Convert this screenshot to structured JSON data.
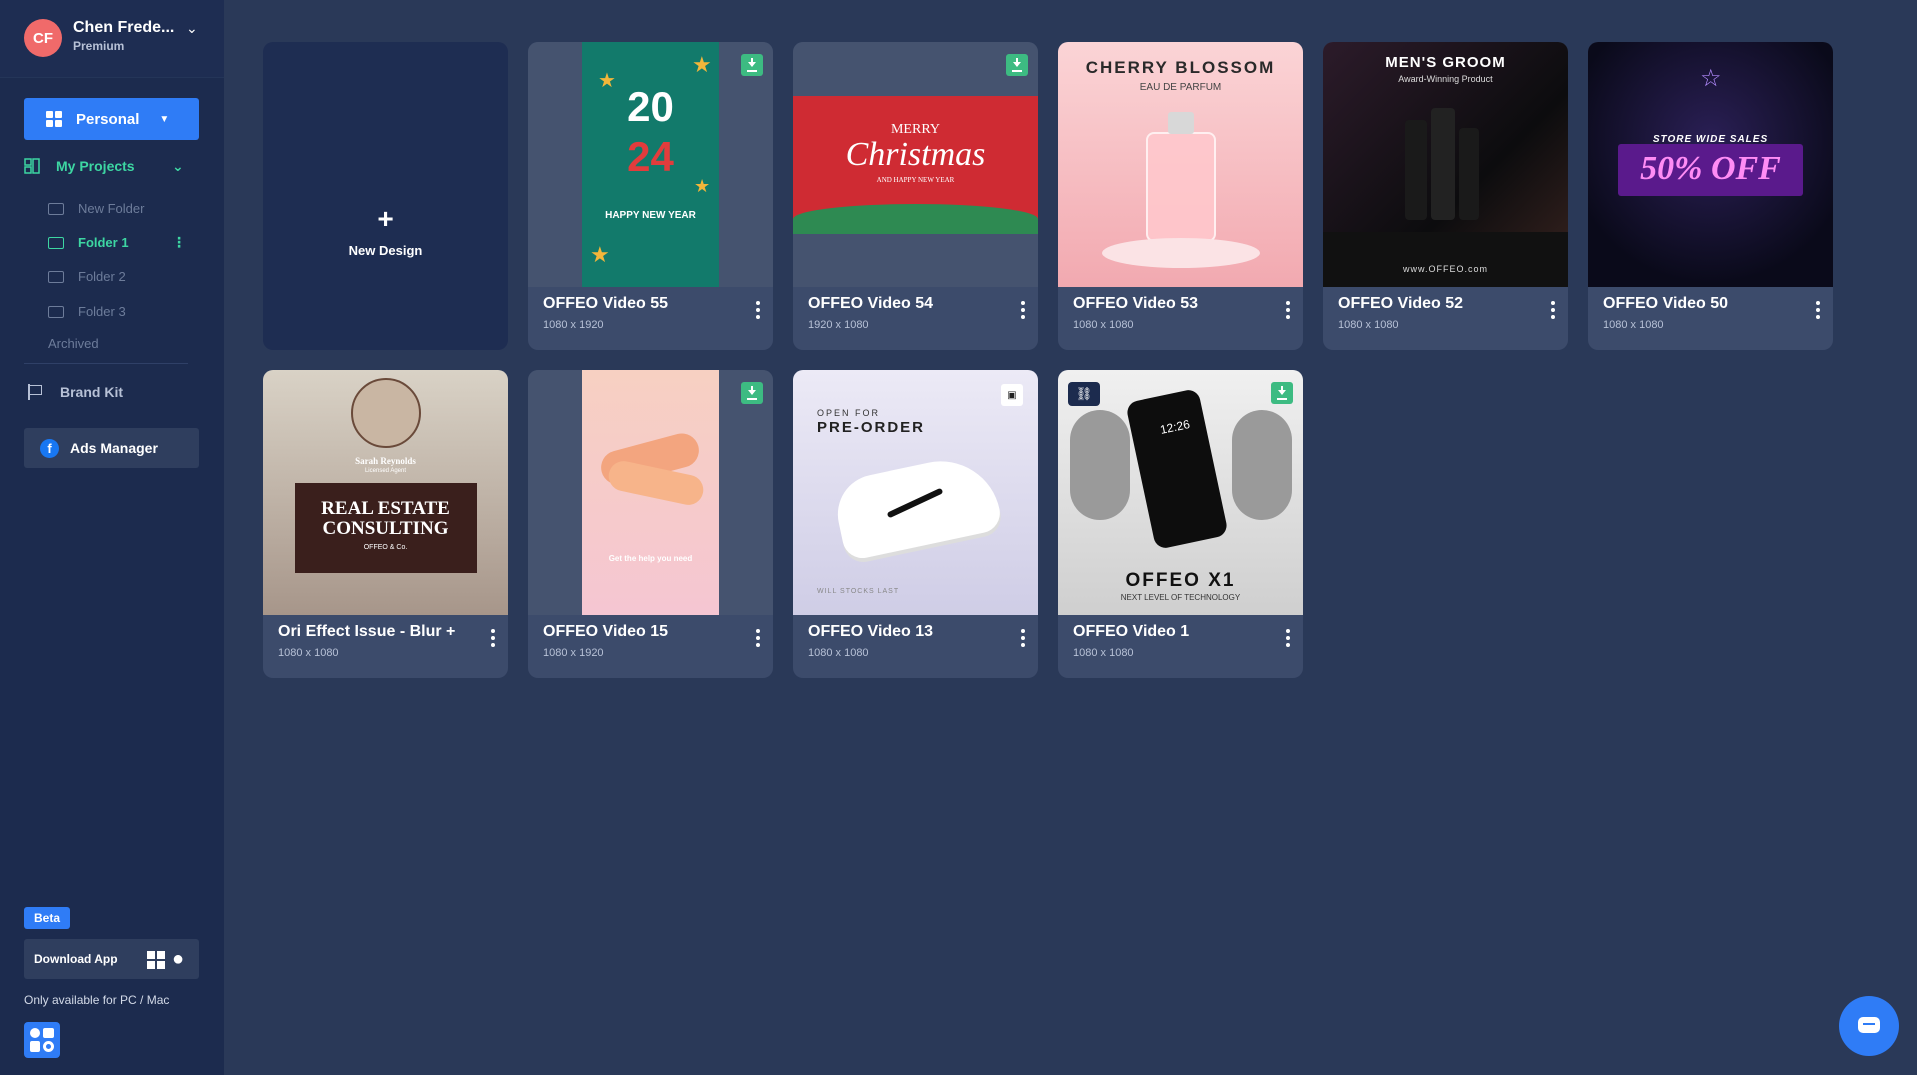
{
  "user": {
    "initials": "CF",
    "name": "Chen Frede...",
    "plan": "Premium"
  },
  "workspace": {
    "label": "Personal"
  },
  "nav": {
    "my_projects": "My Projects",
    "new_folder": "New Folder",
    "folders": [
      "Folder 1",
      "Folder 2",
      "Folder 3"
    ],
    "archived": "Archived",
    "brand_kit": "Brand Kit",
    "ads_manager": "Ads Manager",
    "fb_glyph": "f"
  },
  "footer": {
    "beta": "Beta",
    "download": "Download App",
    "availability": "Only available for PC / Mac"
  },
  "new_design": {
    "label": "New Design"
  },
  "projects": [
    {
      "title": "OFFEO Video 55",
      "size": "1080 x 1920",
      "thumb_text": [
        "20",
        "24",
        "HAPPY NEW YEAR"
      ]
    },
    {
      "title": "OFFEO Video 54",
      "size": "1920 x 1080",
      "thumb_text": [
        "MERRY",
        "Christmas",
        "AND HAPPY NEW YEAR"
      ]
    },
    {
      "title": "OFFEO Video 53",
      "size": "1080 x 1080",
      "thumb_text": [
        "CHERRY BLOSSOM",
        "EAU DE PARFUM"
      ]
    },
    {
      "title": "OFFEO Video 52",
      "size": "1080 x 1080",
      "thumb_text": [
        "MEN'S GROOM",
        "Award-Winning Product",
        "www.OFFEO.com"
      ]
    },
    {
      "title": "OFFEO Video 50",
      "size": "1080 x 1080",
      "thumb_text": [
        "STORE WIDE SALES",
        "50% OFF"
      ]
    },
    {
      "title": "Ori Effect Issue - Blur +",
      "size": "1080 x 1080",
      "thumb_text": [
        "Sarah Reynolds",
        "Licensed Agent",
        "REAL ESTATE",
        "CONSULTING",
        "OFFEO & Co."
      ]
    },
    {
      "title": "OFFEO Video 15",
      "size": "1080 x 1920",
      "thumb_text": [
        "Get the help you need"
      ]
    },
    {
      "title": "OFFEO Video 13",
      "size": "1080 x 1080",
      "thumb_text": [
        "OPEN FOR",
        "PRE-ORDER",
        "WILL STOCKS LAST"
      ]
    },
    {
      "title": "OFFEO Video 1",
      "size": "1080 x 1080",
      "thumb_text": [
        "12:26",
        "OFFEO X1",
        "NEXT LEVEL OF TECHNOLOGY"
      ]
    }
  ],
  "colors": {
    "accent": "#2f7cf6",
    "active_green": "#3dd6a2",
    "sidebar": "#1c2b4e",
    "canvas": "#2a3958"
  }
}
